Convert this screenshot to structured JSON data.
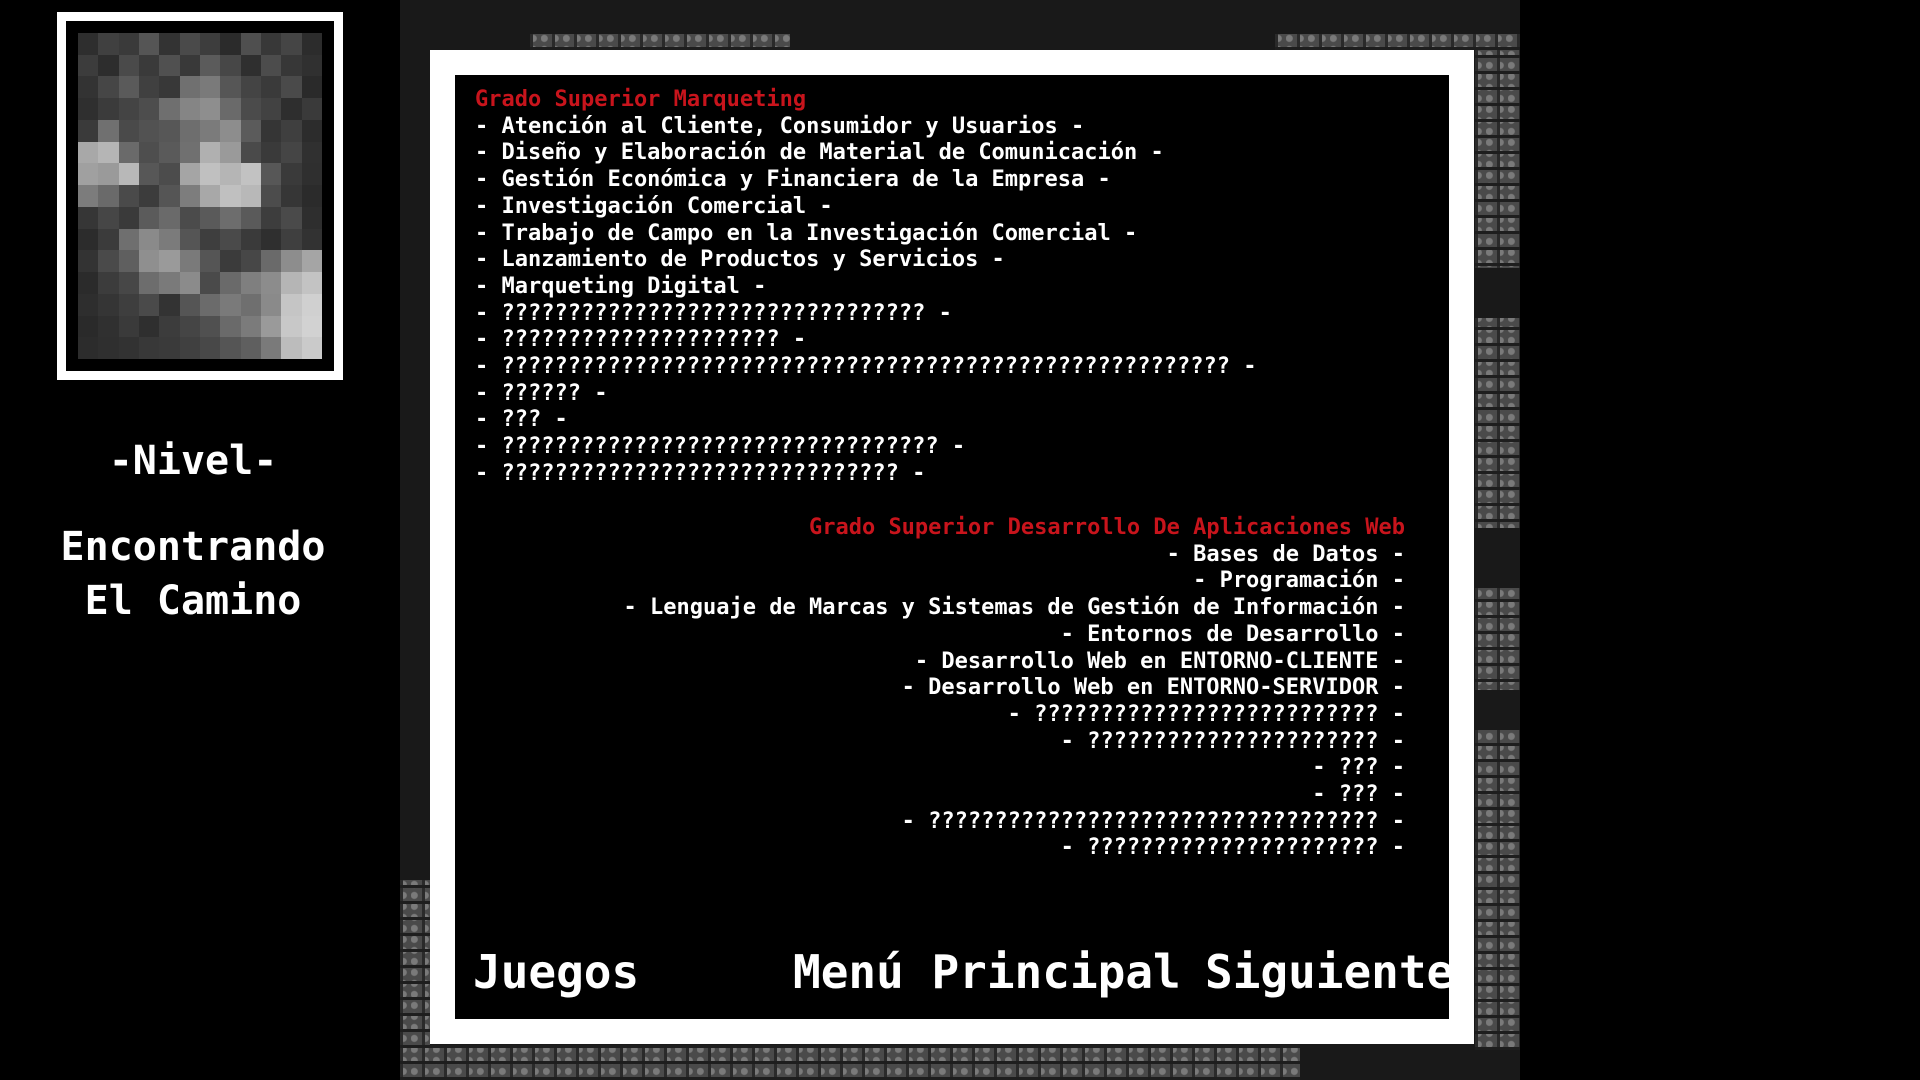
{
  "sidebar": {
    "level_label": "-Nivel-",
    "level_name": "Encontrando\nEl Camino",
    "portrait_pixels": [
      "#2e2e2e",
      "#404040",
      "#3a3a3a",
      "#555555",
      "#333333",
      "#4a4a4a",
      "#3d3d3d",
      "#2b2b2b",
      "#4f4f4f",
      "#383838",
      "#454545",
      "#2c2c2c",
      "#3c3c3c",
      "#2d2d2d",
      "#4a4a4a",
      "#3a3a3a",
      "#505050",
      "#393939",
      "#5b5b5b",
      "#474747",
      "#2f2f2f",
      "#4c4c4c",
      "#373737",
      "#303030",
      "#333333",
      "#464646",
      "#5a5a5a",
      "#404040",
      "#383838",
      "#707070",
      "#7a7a7a",
      "#565656",
      "#444444",
      "#3a3a3a",
      "#4a4a4a",
      "#2a2a2a",
      "#2f2f2f",
      "#3b3b3b",
      "#444444",
      "#4d4d4d",
      "#6f6f6f",
      "#858585",
      "#8e8e8e",
      "#6a6a6a",
      "#4b4b4b",
      "#424242",
      "#2e2e2e",
      "#3a3a3a",
      "#3a3a3a",
      "#707070",
      "#4a4a4a",
      "#525252",
      "#575757",
      "#6e6e6e",
      "#7b7b7b",
      "#8d8d8d",
      "#5b5b5b",
      "#353535",
      "#3f3f3f",
      "#2c2c2c",
      "#a8a8a8",
      "#b5b5b5",
      "#6a6a6a",
      "#4e4e4e",
      "#5a5a5a",
      "#707070",
      "#b0b0b0",
      "#9a9a9a",
      "#4a4a4a",
      "#3a3a3a",
      "#454545",
      "#303030",
      "#a0a0a0",
      "#9a9a9a",
      "#b8b8b8",
      "#575757",
      "#4c4c4c",
      "#a5a5a5",
      "#c0c0c0",
      "#b5b5b5",
      "#c2c2c2",
      "#575757",
      "#3a3a3a",
      "#2f2f2f",
      "#7c7c7c",
      "#6a6a6a",
      "#4a4a4a",
      "#3c3c3c",
      "#555555",
      "#7d7d7d",
      "#a8a8a8",
      "#c0c0c0",
      "#b8b8b8",
      "#4c4c4c",
      "#363636",
      "#2b2b2b",
      "#363636",
      "#464646",
      "#3a3a3a",
      "#5b5b5b",
      "#6a6a6a",
      "#4b4b4b",
      "#5a5a5a",
      "#6d6d6d",
      "#5a5a5a",
      "#3d3d3d",
      "#4a4a4a",
      "#2e2e2e",
      "#2c2c2c",
      "#3b3b3b",
      "#6f6f6f",
      "#8a8a8a",
      "#7b7b7b",
      "#555555",
      "#3e3e3e",
      "#4a4a4a",
      "#3a3a3a",
      "#2f2f2f",
      "#3f3f3f",
      "#323232",
      "#333333",
      "#4a4a4a",
      "#5f5f5f",
      "#8f8f8f",
      "#9a9a9a",
      "#7a7a7a",
      "#555555",
      "#3b3b3b",
      "#474747",
      "#6a6a6a",
      "#8d8d8d",
      "#a5a5a5",
      "#2b2b2b",
      "#3c3c3c",
      "#474747",
      "#6d6d6d",
      "#7a7a7a",
      "#8b8b8b",
      "#4a4a4a",
      "#6a6a6a",
      "#7f7f7f",
      "#8c8c8c",
      "#b5b5b5",
      "#c3c3c3",
      "#2e2e2e",
      "#353535",
      "#3e3e3e",
      "#4a4a4a",
      "#333333",
      "#555555",
      "#6b6b6b",
      "#7a7a7a",
      "#6f6f6f",
      "#8a8a8a",
      "#c5c5c5",
      "#d0d0d0",
      "#2a2a2a",
      "#303030",
      "#3a3a3a",
      "#2f2f2f",
      "#3c3c3c",
      "#454545",
      "#505050",
      "#6a6a6a",
      "#7b7b7b",
      "#9a9a9a",
      "#c8c8c8",
      "#d2d2d2",
      "#2c2c2c",
      "#2f2f2f",
      "#323232",
      "#383838",
      "#3a3a3a",
      "#404040",
      "#484848",
      "#555555",
      "#5f5f5f",
      "#7a7a7a",
      "#bcbcbc",
      "#cacaca"
    ]
  },
  "dialog": {
    "course_1": {
      "title": "Grado Superior Marqueting",
      "items": [
        "- Atención al Cliente, Consumidor y Usuarios -",
        "- Diseño y Elaboración de Material de Comunicación -",
        "- Gestión Económica y Financiera de la Empresa -",
        "- Investigación Comercial -",
        "- Trabajo de Campo en la Investigación Comercial -",
        "- Lanzamiento de Productos y Servicios -",
        "- Marqueting Digital -",
        "- ???????????????????????????????? -",
        "- ????????????????????? -",
        "- ??????????????????????????????????????????????????????? -",
        "- ?????? -",
        "- ??? -",
        "- ????????????????????????????????? -",
        "- ?????????????????????????????? -"
      ]
    },
    "course_2": {
      "title": "Grado Superior Desarrollo De Aplicaciones Web",
      "items": [
        "- Bases de Datos -",
        "- Programación -",
        "- Lenguaje de Marcas y Sistemas de Gestión de Información -",
        "- Entornos de Desarrollo -",
        "- Desarrollo Web en ENTORNO-CLIENTE -",
        "- Desarrollo Web en ENTORNO-SERVIDOR -",
        "- ?????????????????????????? -",
        "- ?????????????????????? -",
        "- ??? -",
        "- ??? -",
        "- ?????????????????????????????????? -",
        "- ?????????????????????? -"
      ]
    },
    "buttons": {
      "games": "Juegos",
      "main_menu": "Menú Principal",
      "next": "Siguiente"
    }
  },
  "colors": {
    "course_title": "#c8141c",
    "text": "#ffffff",
    "panel_bg": "#000000",
    "frame": "#ffffff"
  }
}
